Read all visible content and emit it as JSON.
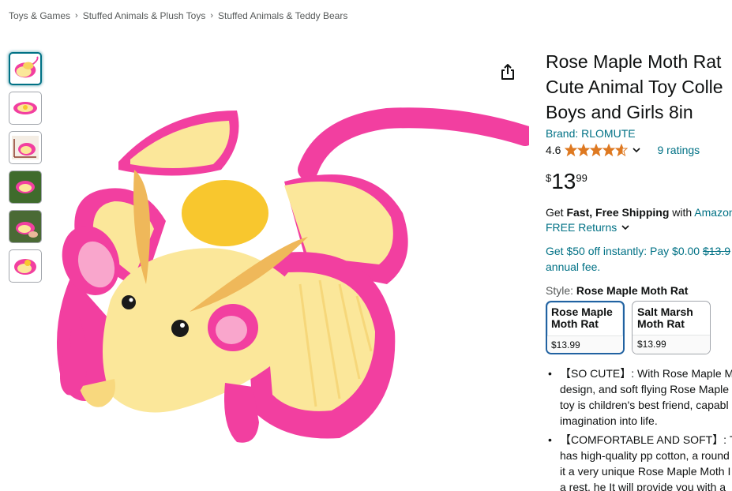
{
  "breadcrumb": [
    {
      "label": "Toys & Games"
    },
    {
      "label": "Stuffed Animals & Plush Toys"
    },
    {
      "label": "Stuffed Animals & Teddy Bears"
    }
  ],
  "breadcrumb_separator": "›",
  "thumbnails": [
    {
      "icon": "plush-front-view"
    },
    {
      "icon": "plush-top-view"
    },
    {
      "icon": "plush-size-chart"
    },
    {
      "icon": "plush-outdoor-green"
    },
    {
      "icon": "plush-in-hand"
    },
    {
      "icon": "plush-side-view"
    }
  ],
  "share_icon": "share-icon",
  "product": {
    "title_lines": [
      "Rose Maple Moth Rat",
      "Cute Animal Toy Colle",
      "Boys and Girls 8in"
    ],
    "brand": "Brand: RLOMUTE",
    "rating_value": "4.6",
    "ratings_count": "9 ratings",
    "stars_filled_fraction": 0.92,
    "price_symbol": "$",
    "price_whole": "13",
    "price_fraction": "99",
    "shipping_get": "Get ",
    "shipping_fast": "Fast, Free Shipping",
    "shipping_with": " with ",
    "shipping_amazon": "Amazon",
    "free_returns": "FREE Returns",
    "promo_line1_a": "Get $50 off instantly: Pay $0.00 ",
    "promo_line1_strike": "$13.9",
    "promo_line2": "annual fee.",
    "style_label": "Style: ",
    "style_value": "Rose Maple Moth Rat",
    "swatches": [
      {
        "name": "Rose Maple Moth Rat",
        "price": "$13.99",
        "selected": true
      },
      {
        "name": "Salt Marsh Moth Rat",
        "price": "$13.99",
        "selected": false
      }
    ],
    "bullets": [
      {
        "lines": [
          "【SO CUTE】: With Rose Maple Mo",
          "design, and soft flying Rose Maple",
          "toy is children's best friend, capabl",
          "imagination into life."
        ]
      },
      {
        "lines": [
          "【COMFORTABLE AND SOFT】: Th",
          "has high-quality pp cotton, a round",
          "it a very unique Rose Maple Moth I",
          "a rest. he It will provide you with a"
        ]
      }
    ]
  },
  "colors": {
    "link": "#007185",
    "star": "#de7921",
    "selected_border": "#2162a1",
    "plush_pink": "#f23fa0",
    "plush_yellow": "#fbe79a"
  }
}
